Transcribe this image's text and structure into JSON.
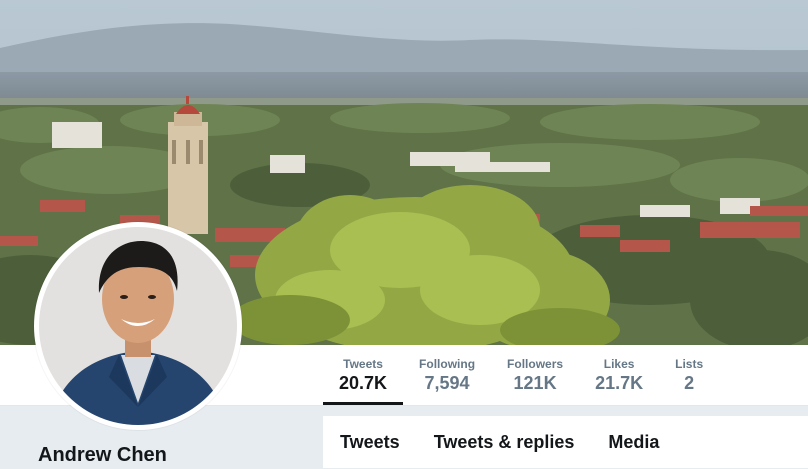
{
  "profile": {
    "name": "Andrew Chen"
  },
  "stats": [
    {
      "label": "Tweets",
      "value": "20.7K",
      "active": true
    },
    {
      "label": "Following",
      "value": "7,594",
      "active": false
    },
    {
      "label": "Followers",
      "value": "121K",
      "active": false
    },
    {
      "label": "Likes",
      "value": "21.7K",
      "active": false
    },
    {
      "label": "Lists",
      "value": "2",
      "active": false
    }
  ],
  "tabs": [
    {
      "label": "Tweets"
    },
    {
      "label": "Tweets & replies"
    },
    {
      "label": "Media"
    }
  ],
  "colors": {
    "page_background": "#e6ecf0",
    "text_primary": "#14171a",
    "text_secondary": "#657786",
    "active_underline": "#14171a"
  }
}
